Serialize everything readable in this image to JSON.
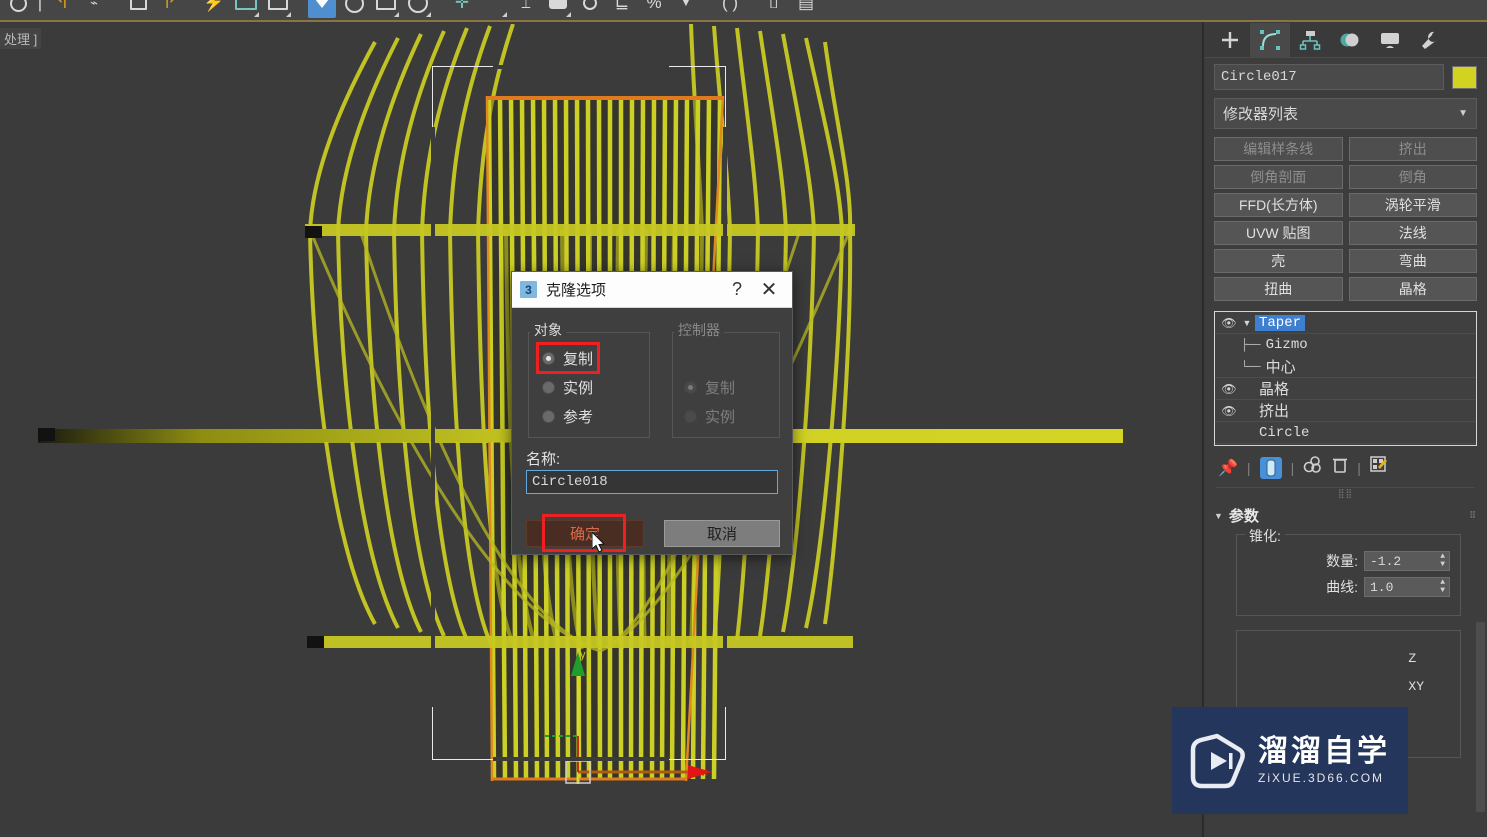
{
  "app": {
    "viewport_label": "处理 ]"
  },
  "toolbar": {
    "icons": [
      "search-icon",
      "align-icon",
      "layer-icon",
      "snap-icon",
      "angle-snap-icon",
      "percent-snap-icon",
      "spinner-snap-icon",
      "select-filter-icon",
      "named-set-icon",
      "mirror-icon",
      "arrange-icon",
      "render-setup-icon",
      "render-frame-icon",
      "render-production-icon",
      "curve-editor-icon",
      "schematic-view-icon"
    ]
  },
  "dialog": {
    "icon_label": "3",
    "title": "克隆选项",
    "help_label": "?",
    "close_label": "✕",
    "object_group": {
      "title": "对象",
      "options": [
        {
          "label": "复制",
          "selected": true,
          "highlighted": true
        },
        {
          "label": "实例",
          "selected": false,
          "highlighted": false
        },
        {
          "label": "参考",
          "selected": false,
          "highlighted": false
        }
      ]
    },
    "controller_group": {
      "title": "控制器",
      "disabled": true,
      "options": [
        {
          "label": "复制",
          "selected": true
        },
        {
          "label": "实例",
          "selected": false
        }
      ]
    },
    "name_label": "名称:",
    "name_value": "Circle018",
    "ok_label": "确定",
    "cancel_label": "取消"
  },
  "command_panel": {
    "tabs": [
      {
        "name": "create-tab",
        "glyph": "+",
        "active": false
      },
      {
        "name": "modify-tab",
        "glyph": "",
        "active": true
      },
      {
        "name": "hierarchy-tab",
        "glyph": "",
        "active": false
      },
      {
        "name": "motion-tab",
        "glyph": "",
        "active": false
      },
      {
        "name": "display-tab",
        "glyph": "",
        "active": false
      },
      {
        "name": "utilities-tab",
        "glyph": "",
        "active": false
      }
    ],
    "object_name": "Circle017",
    "object_color": "#d2d221",
    "modifier_list_label": "修改器列表",
    "modifier_buttons": [
      {
        "label": "编辑样条线",
        "disabled": true
      },
      {
        "label": "挤出",
        "disabled": true
      },
      {
        "label": "倒角剖面",
        "disabled": true
      },
      {
        "label": "倒角",
        "disabled": true
      },
      {
        "label": "FFD(长方体)",
        "disabled": false
      },
      {
        "label": "涡轮平滑",
        "disabled": false
      },
      {
        "label": "UVW 贴图",
        "disabled": false
      },
      {
        "label": "法线",
        "disabled": false
      },
      {
        "label": "壳",
        "disabled": false
      },
      {
        "label": "弯曲",
        "disabled": false
      },
      {
        "label": "扭曲",
        "disabled": false
      },
      {
        "label": "晶格",
        "disabled": false
      }
    ],
    "modifier_stack": [
      {
        "label": "Taper",
        "selected": true,
        "eye": true,
        "expand": true,
        "mono": true
      },
      {
        "label": "Gizmo",
        "sub": true,
        "tree": "├──",
        "mono": true
      },
      {
        "label": "中心",
        "sub": true,
        "tree": "└──",
        "mono": false
      },
      {
        "label": "晶格",
        "eye": true,
        "mono": false
      },
      {
        "label": "挤出",
        "eye": true,
        "mono": false
      },
      {
        "label": "Circle",
        "base": true,
        "mono": true
      }
    ],
    "stack_tools": [
      "pin-stack-icon",
      "show-end-result-icon",
      "make-unique-icon",
      "remove-modifier-icon",
      "configure-modifier-sets-icon"
    ],
    "parameters": {
      "rollout_title": "参数",
      "taper_group_title": "锥化:",
      "amount_label": "数量:",
      "amount_value": "-1.2",
      "curve_label": "曲线:",
      "curve_value": "1.0",
      "axis_labels": [
        "Z",
        "XY"
      ]
    }
  },
  "watermark": {
    "cn": "溜溜自学",
    "en": "ZiXUE.3D66.COM",
    "bg": "#25365c"
  }
}
